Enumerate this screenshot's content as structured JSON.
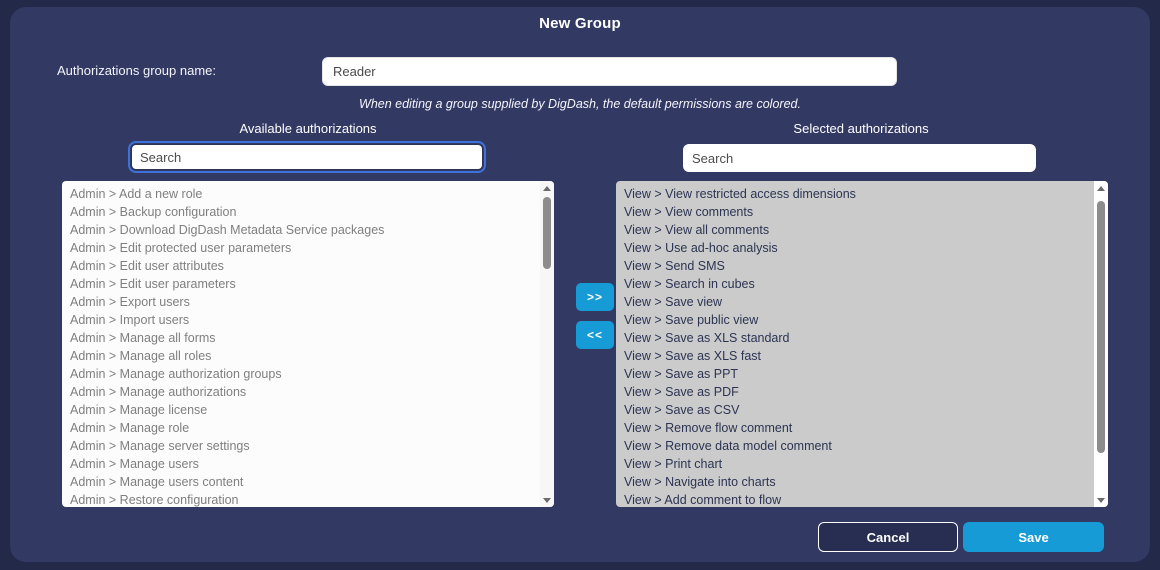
{
  "colors": {
    "outer_bg": "#232949",
    "dialog_bg": "#323963",
    "accent": "#179bd7",
    "focus_ring": "#3d72d9",
    "list_left_bg": "#fcfcfc",
    "list_left_text": "#7f7f7f",
    "list_right_bg": "#cbcbcb",
    "list_right_text": "#2c3452"
  },
  "dialog": {
    "title": "New Group",
    "name_label": "Authorizations group name:",
    "name_value": "Reader",
    "note": "When editing a group supplied by DigDash, the default permissions are colored.",
    "available": {
      "header": "Available authorizations",
      "search_placeholder": "Search",
      "items": [
        "Admin > Add a new role",
        "Admin > Backup configuration",
        "Admin > Download DigDash Metadata Service packages",
        "Admin > Edit protected user parameters",
        "Admin > Edit user attributes",
        "Admin > Edit user parameters",
        "Admin > Export users",
        "Admin > Import users",
        "Admin > Manage all forms",
        "Admin > Manage all roles",
        "Admin > Manage authorization groups",
        "Admin > Manage authorizations",
        "Admin > Manage license",
        "Admin > Manage role",
        "Admin > Manage server settings",
        "Admin > Manage users",
        "Admin > Manage users content",
        "Admin > Restore configuration"
      ]
    },
    "selected": {
      "header": "Selected authorizations",
      "search_placeholder": "Search",
      "items": [
        "View > View restricted access dimensions",
        "View > View comments",
        "View > View all comments",
        "View > Use ad-hoc analysis",
        "View > Send SMS",
        "View > Search in cubes",
        "View > Save view",
        "View > Save public view",
        "View > Save as XLS standard",
        "View > Save as XLS fast",
        "View > Save as PPT",
        "View > Save as PDF",
        "View > Save as CSV",
        "View > Remove flow comment",
        "View > Remove data model comment",
        "View > Print chart",
        "View > Navigate into charts",
        "View > Add comment to flow"
      ]
    },
    "transfer": {
      "add_label": ">>",
      "remove_label": "<<"
    },
    "footer": {
      "cancel_label": "Cancel",
      "save_label": "Save"
    }
  }
}
